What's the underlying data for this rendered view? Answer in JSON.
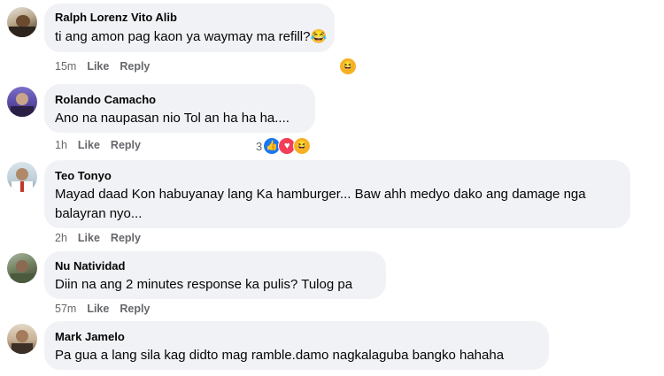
{
  "comments": [
    {
      "name": "Ralph Lorenz Vito Alib",
      "text": "ti ang amon pag kaon ya waymay ma refill?😂",
      "time": "15m",
      "like": "Like",
      "reply": "Reply",
      "reactions": {
        "count": "",
        "types": [
          "haha"
        ]
      }
    },
    {
      "name": "Rolando Camacho",
      "text": "Ano na naupasan nio Tol an ha ha ha....",
      "time": "1h",
      "like": "Like",
      "reply": "Reply",
      "reactions": {
        "count": "3",
        "types": [
          "like",
          "love",
          "haha"
        ]
      }
    },
    {
      "name": "Teo Tonyo",
      "text": "Mayad daad Kon habuyanay lang Ka hamburger... Baw ahh medyo dako ang damage nga balayran nyo...",
      "time": "2h",
      "like": "Like",
      "reply": "Reply"
    },
    {
      "name": "Nu Natividad",
      "text": "Diin na ang 2 minutes response ka pulis? Tulog pa",
      "time": "57m",
      "like": "Like",
      "reply": "Reply"
    },
    {
      "name": "Mark Jamelo",
      "text": "Pa gua a lang sila kag didto mag ramble.damo nagkalaguba bangko hahaha",
      "time": "",
      "like": "",
      "reply": ""
    }
  ],
  "colors": {
    "bubble": "#f0f2f5",
    "meta": "#65676b",
    "like": "#1877f2",
    "love": "#f33e58",
    "haha": "#f7b125"
  },
  "icons": {
    "like": "thumbs-up-icon",
    "love": "heart-icon",
    "haha": "laughing-face-icon"
  }
}
